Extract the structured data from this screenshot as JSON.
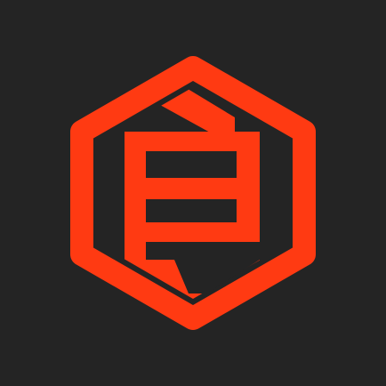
{
  "background_color": "#242424",
  "logo": {
    "icon": "hexagon-monogram-logo-icon",
    "color": "#ff3a12"
  }
}
